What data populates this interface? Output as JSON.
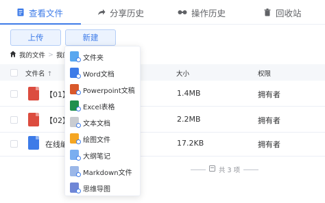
{
  "tabs": [
    {
      "label": "查看文件",
      "icon": "document-icon"
    },
    {
      "label": "分享历史",
      "icon": "share-icon"
    },
    {
      "label": "操作历史",
      "icon": "history-icon"
    },
    {
      "label": "回收站",
      "icon": "trash-icon"
    }
  ],
  "toolbar": {
    "upload_label": "上传",
    "new_label": "新建"
  },
  "breadcrumb": {
    "home_label": "我的文件",
    "separator": ">",
    "current_label": "我的"
  },
  "table": {
    "headers": {
      "name": "文件名",
      "sort_icon": "↑",
      "size": "大小",
      "permission": "权限"
    },
    "rows": [
      {
        "name": "【01】",
        "size": "1.4MB",
        "permission": "拥有者",
        "type": "pdf"
      },
      {
        "name": "【02】",
        "size": "2.2MB",
        "permission": "拥有者",
        "type": "pdf"
      },
      {
        "name": "在线编",
        "size": "17.2KB",
        "permission": "拥有者",
        "type": "word"
      }
    ],
    "footer": "共 3 项"
  },
  "new_menu": {
    "items": [
      {
        "label": "文件夹",
        "icon": "folder-icon",
        "color": "#5aa7ef"
      },
      {
        "label": "Word文档",
        "icon": "word-icon",
        "color": "#3d7be8"
      },
      {
        "label": "Powerpoint文稿",
        "icon": "powerpoint-icon",
        "color": "#d9582b"
      },
      {
        "label": "Excel表格",
        "icon": "excel-icon",
        "color": "#1f8f4e"
      },
      {
        "label": "文本文档",
        "icon": "text-file-icon",
        "color": "#c9ccd1"
      },
      {
        "label": "绘图文件",
        "icon": "drawing-icon",
        "color": "#f5a623"
      },
      {
        "label": "大纲笔记",
        "icon": "outline-note-icon",
        "color": "#7aaef0"
      },
      {
        "label": "Markdown文件",
        "icon": "markdown-icon",
        "color": "#9bb7e8"
      },
      {
        "label": "思维导图",
        "icon": "mind-map-icon",
        "color": "#6f86d6"
      }
    ]
  },
  "colors": {
    "accent": "#3d7be8",
    "pdf": "#dc4c3f",
    "word": "#3d7be8"
  }
}
